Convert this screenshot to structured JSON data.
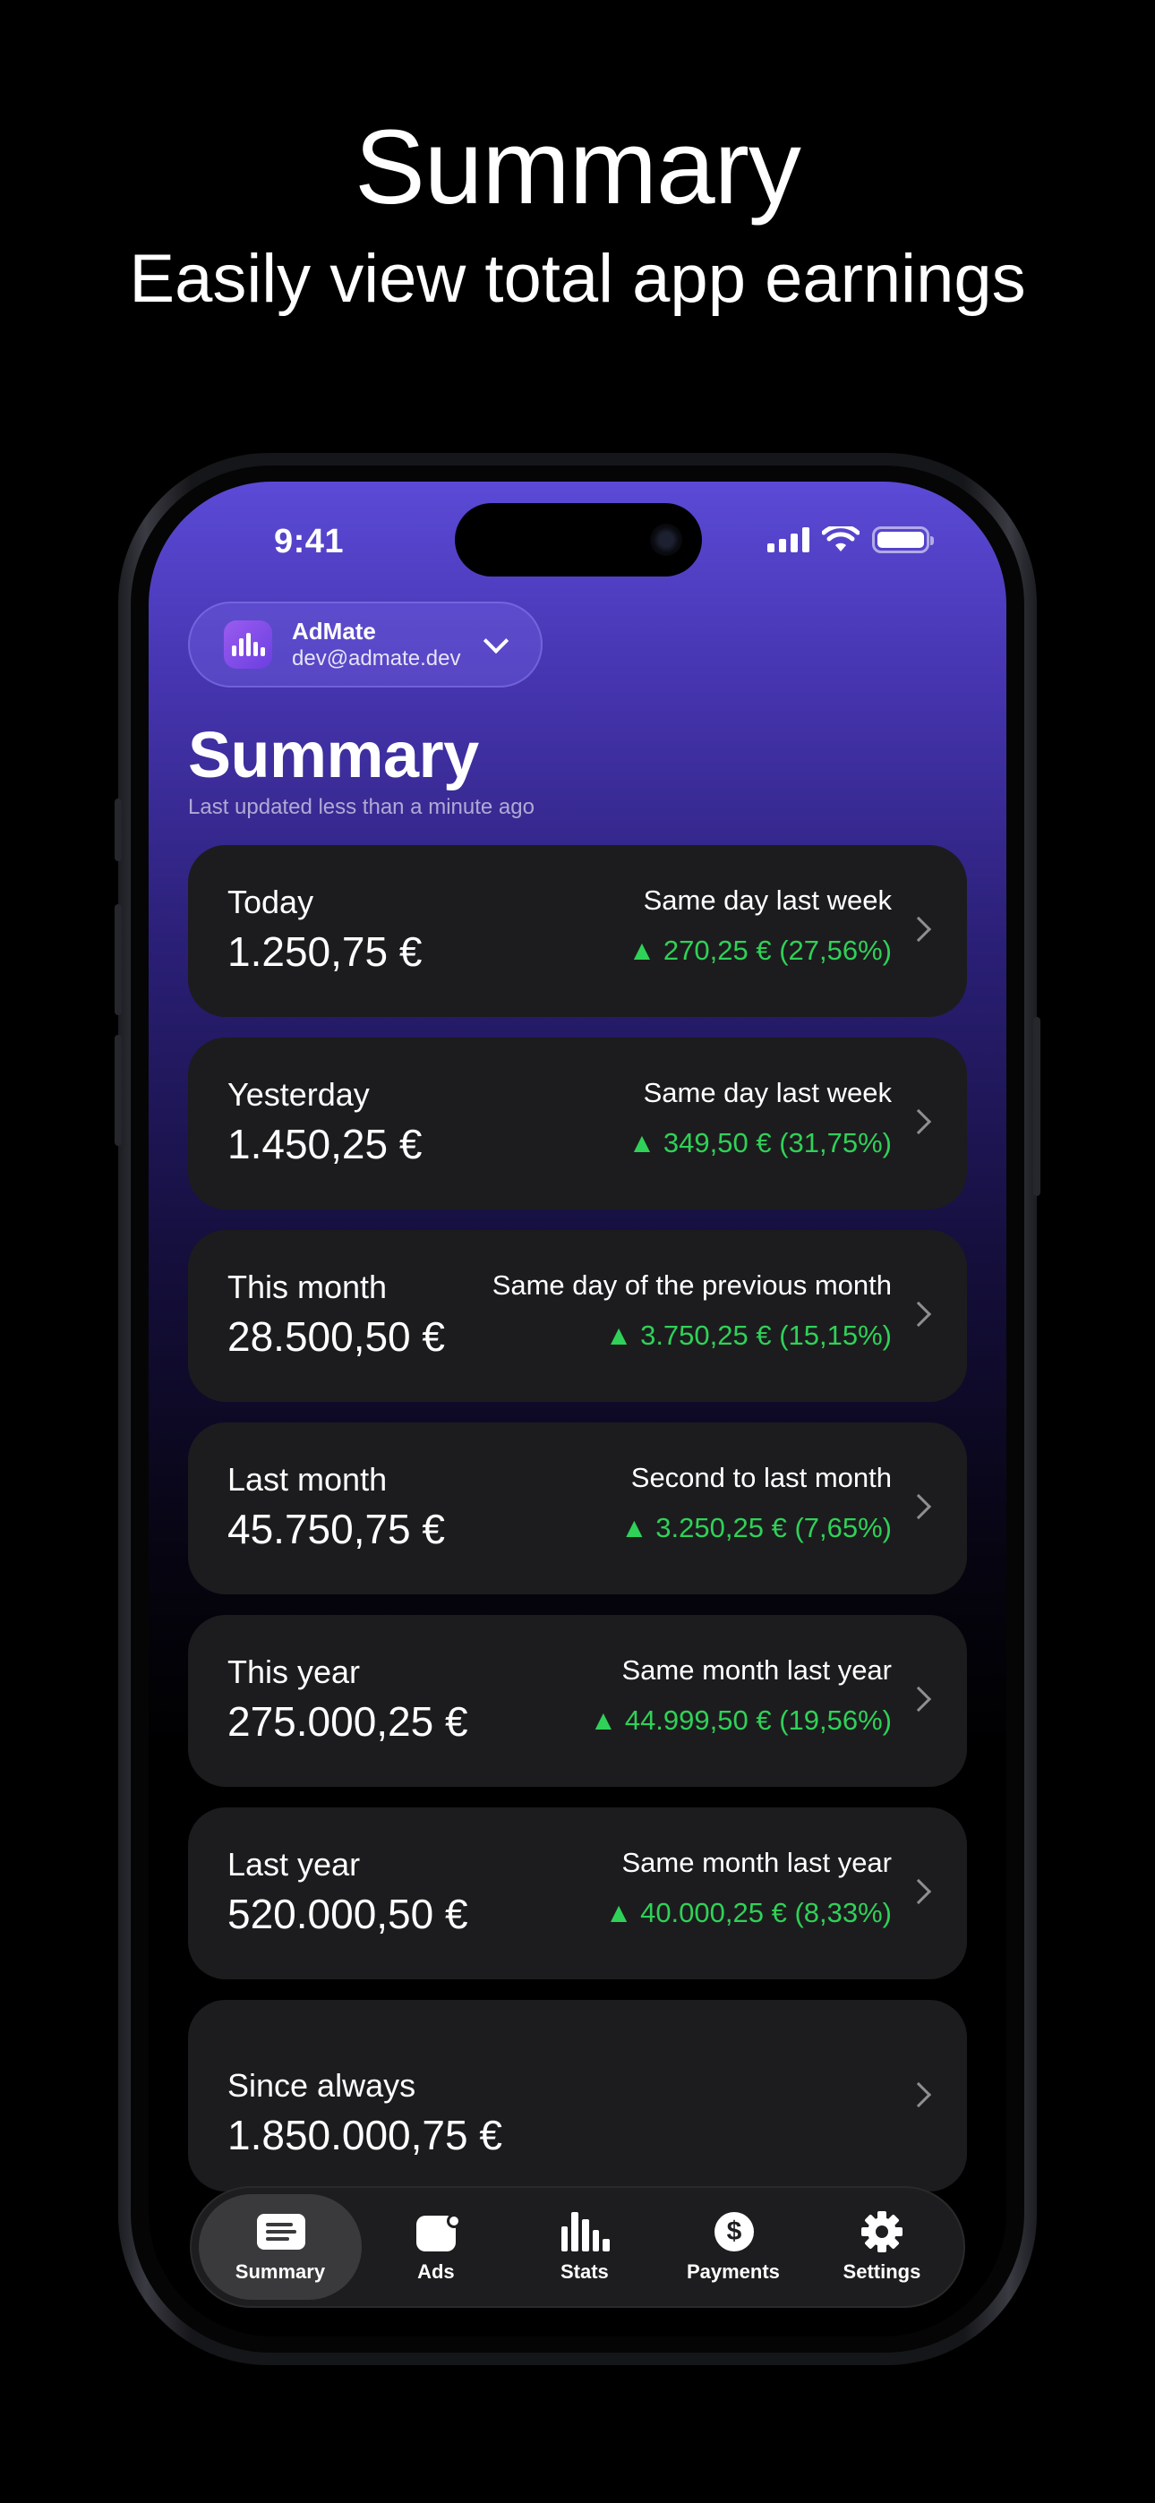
{
  "promo": {
    "title": "Summary",
    "subtitle": "Easily view total app earnings"
  },
  "status_bar": {
    "time": "9:41"
  },
  "account": {
    "name": "AdMate",
    "email": "dev@admate.dev"
  },
  "header": {
    "title": "Summary",
    "subtitle": "Last updated less than a minute ago"
  },
  "cards": [
    {
      "label": "Today",
      "amount": "1.250,75 €",
      "comparison": "Same day last week",
      "delta": "▲ 270,25 € (27,56%)"
    },
    {
      "label": "Yesterday",
      "amount": "1.450,25 €",
      "comparison": "Same day last week",
      "delta": "▲ 349,50 € (31,75%)"
    },
    {
      "label": "This month",
      "amount": "28.500,50 €",
      "comparison": "Same day of the previous month",
      "delta": "▲ 3.750,25 € (15,15%)"
    },
    {
      "label": "Last month",
      "amount": "45.750,75 €",
      "comparison": "Second to last month",
      "delta": "▲ 3.250,25 € (7,65%)"
    },
    {
      "label": "This year",
      "amount": "275.000,25 €",
      "comparison": "Same month last year",
      "delta": "▲ 44.999,50 € (19,56%)"
    },
    {
      "label": "Last year",
      "amount": "520.000,50 €",
      "comparison": "Same month last year",
      "delta": "▲ 40.000,25 € (8,33%)"
    },
    {
      "label": "Since always",
      "amount": "1.850.000,75 €"
    }
  ],
  "tabs": [
    {
      "label": "Summary",
      "icon": "summary-icon",
      "active": true
    },
    {
      "label": "Ads",
      "icon": "ads-icon"
    },
    {
      "label": "Stats",
      "icon": "stats-icon"
    },
    {
      "label": "Payments",
      "icon": "payments-icon",
      "glyph": "$"
    },
    {
      "label": "Settings",
      "icon": "settings-icon"
    }
  ],
  "colors": {
    "accent": "#5b4ad6",
    "positive": "#30d158",
    "card": "#1c1c1e"
  }
}
